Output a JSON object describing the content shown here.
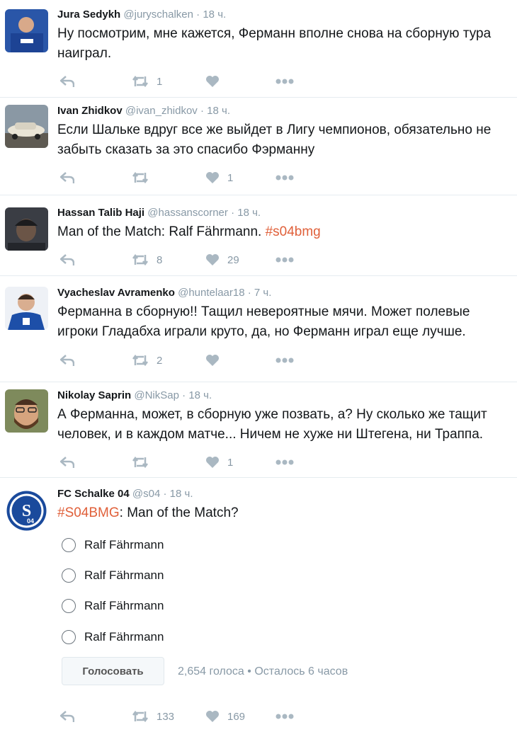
{
  "tweets": [
    {
      "name": "Jura Sedykh",
      "handle": "@juryschalken",
      "sep": "·",
      "time": "18 ч.",
      "text": "Ну посмотрим, мне кажется, Ферманн вполне снова на сборную тура наиграл.",
      "retweets": "1",
      "likes": ""
    },
    {
      "name": "Ivan Zhidkov",
      "handle": "@ivan_zhidkov",
      "sep": "·",
      "time": "18 ч.",
      "text": "Если Шальке вдруг все же выйдет в Лигу чемпионов, обязательно не забыть сказать за это спасибо Фэрманну",
      "retweets": "",
      "likes": "1"
    },
    {
      "name": "Hassan Talib Haji",
      "handle": "@hassanscorner",
      "sep": "·",
      "time": "18 ч.",
      "text": "Man of the Match: Ralf Fährmann. ",
      "hashtag": "#s04bmg",
      "retweets": "8",
      "likes": "29"
    },
    {
      "name": "Vyacheslav Avramenko",
      "handle": "@huntelaar18",
      "sep": "·",
      "time": "7 ч.",
      "text": "Ферманна в сборную!! Тащил невероятные мячи. Может полевые игроки Гладабха играли круто, да, но Ферманн играл еще лучше.",
      "retweets": "2",
      "likes": ""
    },
    {
      "name": "Nikolay Saprin",
      "handle": "@NikSap",
      "sep": "·",
      "time": "18 ч.",
      "text": "А Ферманна, может, в сборную уже позвать, а? Ну сколько же тащит человек, и в каждом матче... Ничем не хуже ни Штегена, ни Траппа.",
      "retweets": "",
      "likes": "1"
    },
    {
      "name": "FC Schalke 04",
      "handle": "@s04",
      "sep": "·",
      "time": "18 ч.",
      "hashtag": "#S04BMG",
      "text": ": Man of the Match?",
      "retweets": "133",
      "likes": "169"
    }
  ],
  "poll": {
    "options": [
      "Ralf Fährmann",
      "Ralf Fährmann",
      "Ralf Fährmann",
      "Ralf Fährmann"
    ],
    "vote_label": "Голосовать",
    "votes": "2,654 голоса",
    "dot": "•",
    "remaining": "Осталось 6 часов"
  },
  "colors": {
    "accent": "#e0603a",
    "icon": "#aab8c2",
    "schalke_blue": "#1a4a9c"
  }
}
